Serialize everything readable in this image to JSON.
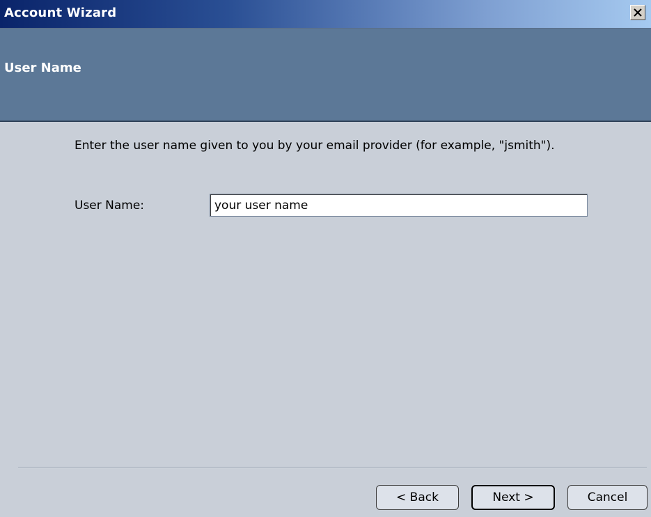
{
  "window": {
    "title": "Account Wizard",
    "close_icon": "close-icon"
  },
  "header": {
    "title": "User Name"
  },
  "content": {
    "instruction": "Enter the user name given to you by your email provider (for example, \"jsmith\").",
    "username_label": "User Name:",
    "username_value": "your user name"
  },
  "buttons": {
    "back_label": "< Back",
    "next_label": "Next >",
    "cancel_label": "Cancel"
  },
  "colors": {
    "titlebar_start": "#0a246a",
    "titlebar_end": "#a6caf0",
    "header_band": "#5c7897",
    "dialog_bg": "#c9cfd8"
  }
}
